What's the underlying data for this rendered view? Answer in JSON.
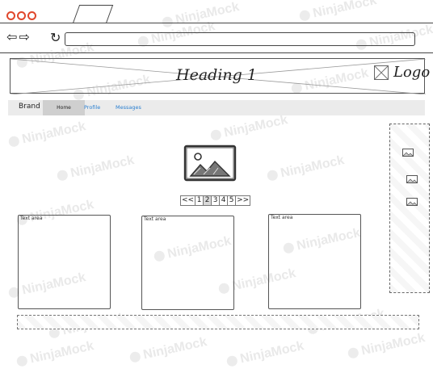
{
  "browser": {
    "window_dots": [
      "red-dot",
      "red-dot",
      "red-dot"
    ],
    "back_icon": "arrow-left-icon",
    "forward_icon": "arrow-right-icon",
    "reload_icon": "reload-icon",
    "url": "",
    "accent": "#e0472c"
  },
  "header": {
    "heading": "Heading 1",
    "logo_label": "Logo",
    "logo_icon": "image-placeholder-icon"
  },
  "navbar": {
    "brand": "Brand",
    "items": [
      {
        "label": "Home",
        "active": true
      },
      {
        "label": "Profile"
      },
      {
        "label": "Messages"
      }
    ],
    "link_color": "#2a7fd0"
  },
  "pagination": {
    "items": [
      "<<",
      "1",
      "2",
      "3",
      "4",
      "5",
      ">>"
    ],
    "active": "2"
  },
  "textareas": [
    {
      "label": "Text area"
    },
    {
      "label": "Text area"
    },
    {
      "label": "Text area"
    }
  ],
  "sidebar": {
    "images": [
      "image-icon",
      "image-icon",
      "image-icon"
    ]
  },
  "watermark": "NinjaMock"
}
